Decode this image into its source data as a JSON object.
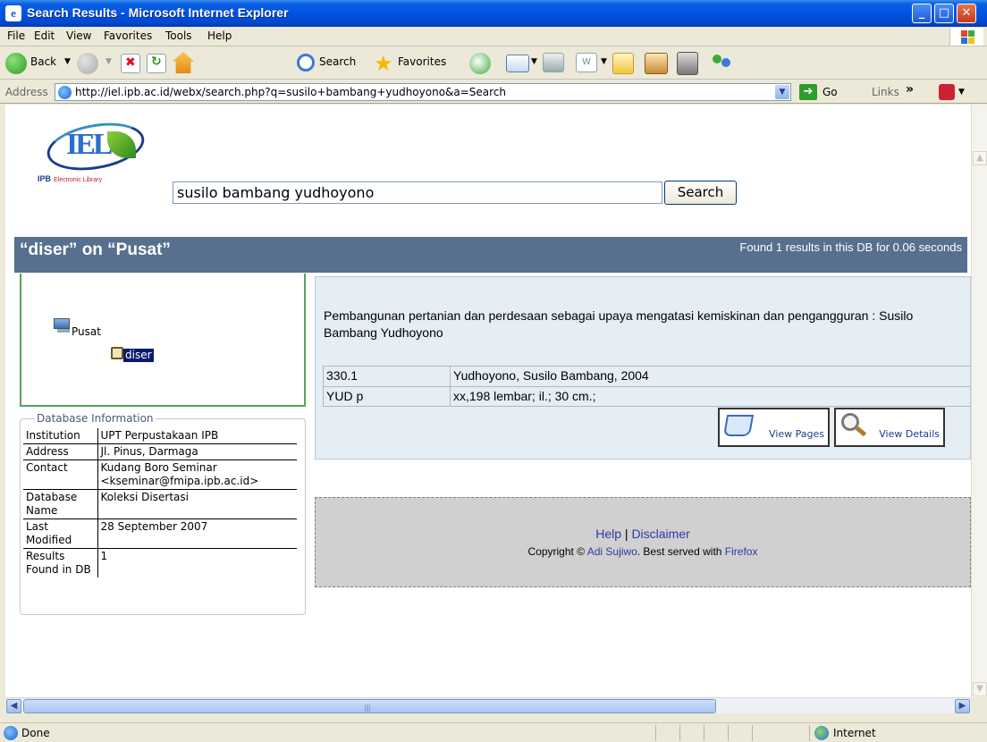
{
  "window": {
    "title": "Search Results - Microsoft Internet Explorer"
  },
  "menu": [
    "File",
    "Edit",
    "View",
    "Favorites",
    "Tools",
    "Help"
  ],
  "toolbar": {
    "back": "Back",
    "search": "Search",
    "favorites": "Favorites"
  },
  "address": {
    "label": "Address",
    "url": "http://iel.ipb.ac.id/webx/search.php?q=susilo+bambang+yudhoyono&a=Search",
    "go": "Go",
    "links": "Links"
  },
  "search": {
    "query": "susilo bambang yudhoyono",
    "button": "Search"
  },
  "logo": {
    "small_text": "IPB",
    "tagline": "Electronic Library"
  },
  "db_header": {
    "title": "“diser” on “Pusat”",
    "found": "Found 1 results in this DB for 0.06 seconds"
  },
  "tree": {
    "root": "Pusat",
    "child": "diser"
  },
  "db_info": {
    "legend": "Database Information",
    "rows": [
      {
        "k": "Institution",
        "v": "UPT Perpustakaan IPB"
      },
      {
        "k": "Address",
        "v": "Jl. Pinus, Darmaga"
      },
      {
        "k": "Contact",
        "v": "Kudang Boro Seminar <kseminar@fmipa.ipb.ac.id>"
      },
      {
        "k": "Database Name",
        "v": "Koleksi Disertasi"
      },
      {
        "k": "Last Modified",
        "v": "28 September 2007"
      },
      {
        "k": "Results Found in DB",
        "v": "1"
      }
    ]
  },
  "result": {
    "title": "Pembangunan pertanian dan perdesaan sebagai upaya mengatasi kemiskinan dan pengangguran : Susilo Bambang Yudhoyono",
    "call1": "330.1",
    "call2": "YUD p",
    "author": "Yudhoyono, Susilo Bambang, 2004",
    "desc": "xx,198 lembar; il.; 30 cm.;",
    "view_pages": "View Pages",
    "view_details": "View Details"
  },
  "footer": {
    "help": "Help",
    "sep": " | ",
    "disclaimer": "Disclaimer",
    "copy_prefix": "Copyright © ",
    "author": "Adi Sujiwo",
    "copy_mid": ". Best served with ",
    "browser": "Firefox"
  },
  "status": {
    "text": "Done",
    "zone": "Internet"
  }
}
